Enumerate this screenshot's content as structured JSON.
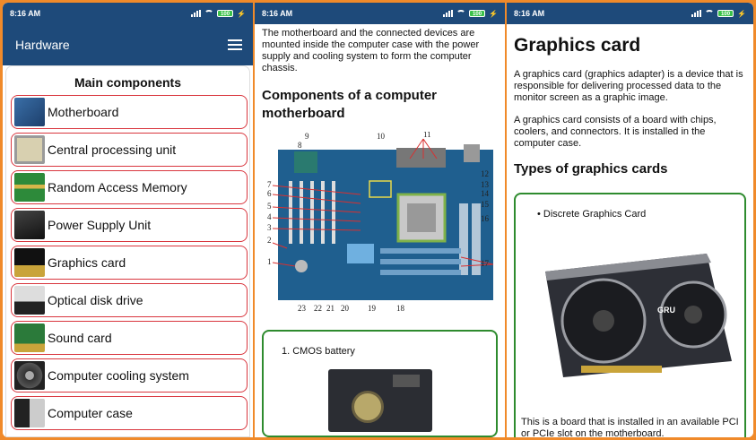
{
  "status": {
    "time": "8:16 AM",
    "battery": "100"
  },
  "app": {
    "title": "Hardware"
  },
  "list": {
    "heading": "Main components",
    "items": [
      {
        "label": "Motherboard",
        "icon": "motherboard-icon"
      },
      {
        "label": "Central processing unit",
        "icon": "cpu-icon"
      },
      {
        "label": "Random Access Memory",
        "icon": "ram-icon"
      },
      {
        "label": "Power Supply Unit",
        "icon": "psu-icon"
      },
      {
        "label": "Graphics card",
        "icon": "gpu-icon"
      },
      {
        "label": "Optical disk drive",
        "icon": "optical-drive-icon"
      },
      {
        "label": "Sound card",
        "icon": "sound-card-icon"
      },
      {
        "label": "Computer cooling system",
        "icon": "cooling-fan-icon"
      },
      {
        "label": "Computer case",
        "icon": "computer-case-icon"
      }
    ]
  },
  "motherboard_page": {
    "intro": "The motherboard and the connected devices are mounted inside the computer case with the power supply and cooling system to form the computer chassis.",
    "heading": "Components of a computer motherboard",
    "diagram_labels": [
      "1",
      "2",
      "3",
      "4",
      "5",
      "6",
      "7",
      "8",
      "9",
      "10",
      "11",
      "12",
      "13",
      "14",
      "15",
      "16",
      "17",
      "18",
      "19",
      "20",
      "21",
      "22",
      "23"
    ],
    "card_item": "1. CMOS battery"
  },
  "graphics_page": {
    "title": "Graphics card",
    "para1": "A graphics card (graphics adapter) is a device that is responsible for delivering processed data to the monitor screen as a graphic image.",
    "para2": "A graphics card consists of a board with chips, coolers, and connectors. It is installed in the computer case.",
    "types_heading": "Types of graphics cards",
    "bullet": "Discrete Graphics Card",
    "gpu_brand": "GRU",
    "caption": "This is a board that is installed in an available PCI or PCIe slot on the motherboard."
  },
  "colors": {
    "appbar": "#1e4a7a",
    "frame": "#f08a2a",
    "item_border": "#d9363e",
    "card_border": "#2e8b2e"
  }
}
